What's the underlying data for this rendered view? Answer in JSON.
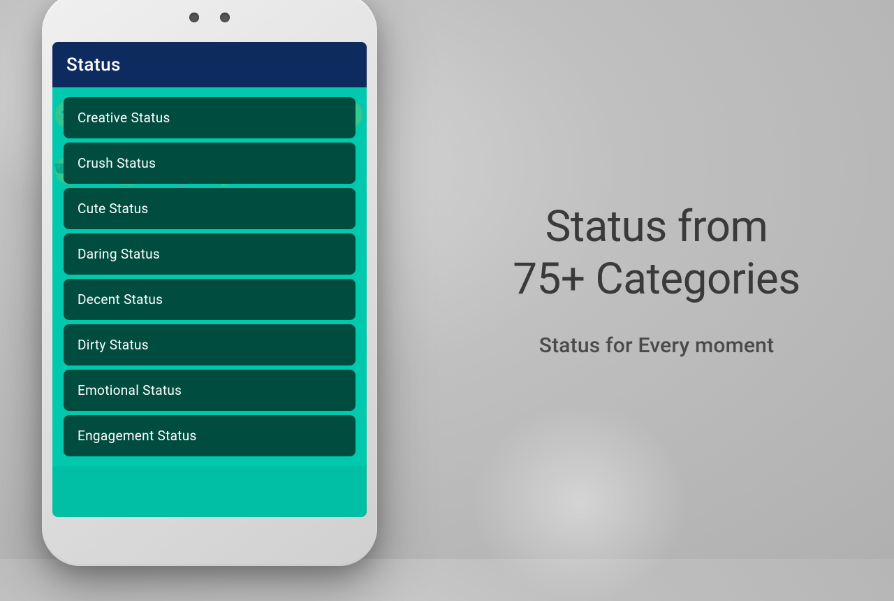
{
  "background": {
    "color": "#c8c8c8"
  },
  "phone": {
    "header": {
      "title": "Status",
      "background_color": "#0d2b5e"
    },
    "list_items": [
      {
        "id": 1,
        "label": "Creative Status"
      },
      {
        "id": 2,
        "label": "Crush Status"
      },
      {
        "id": 3,
        "label": "Cute Status"
      },
      {
        "id": 4,
        "label": "Daring Status"
      },
      {
        "id": 5,
        "label": "Decent Status"
      },
      {
        "id": 6,
        "label": "Dirty Status"
      },
      {
        "id": 7,
        "label": "Emotional Status"
      },
      {
        "id": 8,
        "label": "Engagement Status"
      }
    ]
  },
  "right_panel": {
    "headline": "Status from\n75+ Categories",
    "subheadline": "Status for Every moment"
  },
  "camera_dots": [
    "left-dot",
    "right-dot"
  ]
}
